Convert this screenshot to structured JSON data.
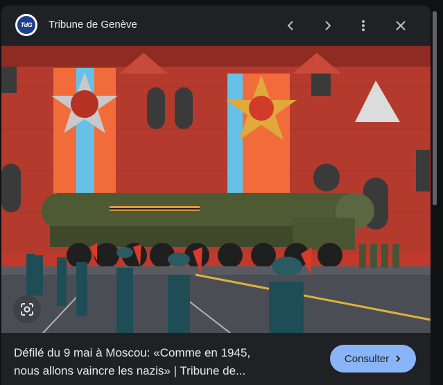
{
  "header": {
    "logo_text": "TdG",
    "site_name": "Tribune de Genève",
    "prev_icon": "chevron-left-icon",
    "next_icon": "chevron-right-icon",
    "menu_icon": "more-vert-icon",
    "close_icon": "close-icon"
  },
  "image": {
    "lens_icon": "google-lens-icon"
  },
  "footer": {
    "caption_line1": "Défilé du 9 mai à Moscou: «Comme en 1945,",
    "caption_line2": "nous allons vaincre les nazis» | Tribune de...",
    "visit_label": "Consulter",
    "visit_icon": "chevron-right-icon"
  },
  "colors": {
    "panel_bg": "#202124",
    "accent": "#8ab4f8",
    "text": "#e8eaed"
  }
}
